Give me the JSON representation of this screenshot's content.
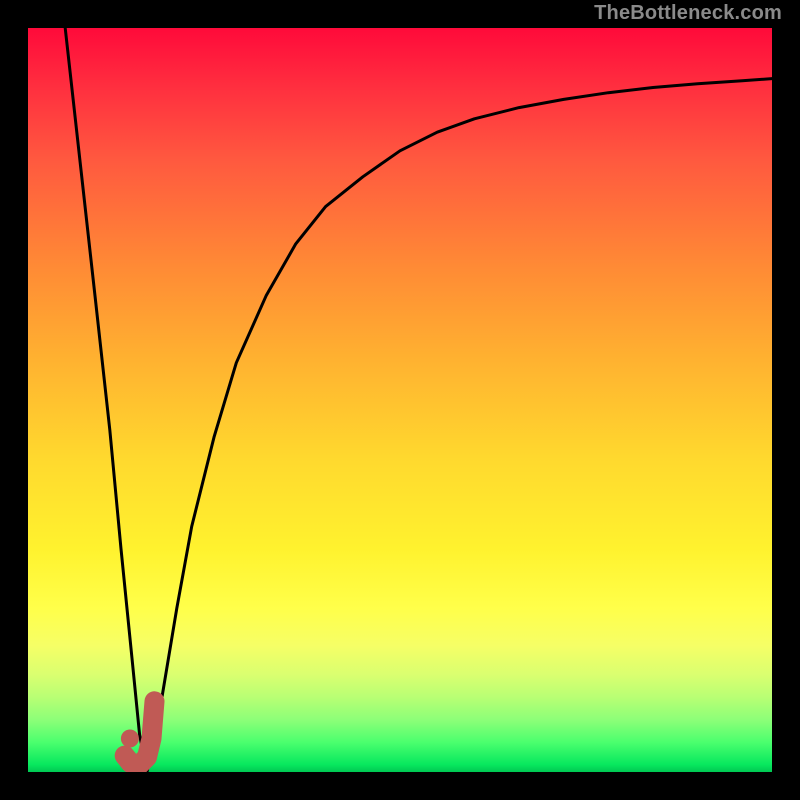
{
  "watermark": {
    "text": "TheBottleneck.com"
  },
  "chart_data": {
    "type": "line",
    "title": "",
    "xlabel": "",
    "ylabel": "",
    "xlim": [
      0,
      100
    ],
    "ylim": [
      0,
      100
    ],
    "series": [
      {
        "name": "bottleneck-curve",
        "x": [
          5,
          7,
          9,
          11,
          12.5,
          14,
          15,
          16,
          18,
          20,
          22,
          25,
          28,
          32,
          36,
          40,
          45,
          50,
          55,
          60,
          66,
          72,
          78,
          84,
          90,
          96,
          100
        ],
        "y": [
          100,
          82,
          64,
          46,
          30,
          15,
          5,
          0,
          10,
          22,
          33,
          45,
          55,
          64,
          71,
          76,
          80,
          83.5,
          86,
          87.8,
          89.3,
          90.4,
          91.3,
          92,
          92.5,
          92.9,
          93.2
        ]
      }
    ],
    "marker": {
      "name": "j-marker",
      "dot": {
        "x": 13.7,
        "y": 4.5
      },
      "stroke": [
        {
          "x": 17.0,
          "y": 9.5
        },
        {
          "x": 16.6,
          "y": 4.5
        },
        {
          "x": 16.0,
          "y": 2.0
        },
        {
          "x": 15.0,
          "y": 1.0
        },
        {
          "x": 13.8,
          "y": 1.2
        },
        {
          "x": 13.0,
          "y": 2.2
        }
      ]
    },
    "background_gradient": {
      "top": "#ff0a3a",
      "mid": "#ffff4a",
      "bottom": "#00c853"
    }
  }
}
